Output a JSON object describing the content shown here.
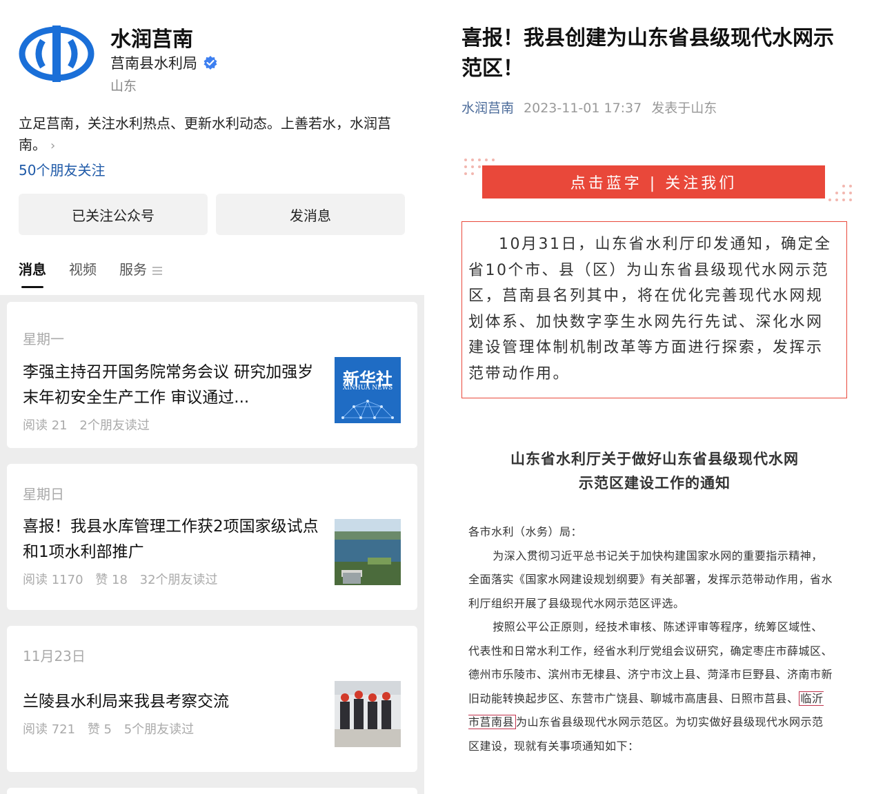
{
  "profile": {
    "name": "水润莒南",
    "org": "莒南县水利局",
    "region": "山东",
    "intro": "立足莒南，关注水利热点、更新水利动态。上善若水，水润莒南。",
    "friends": "50个朋友关注",
    "follow_button": "已关注公众号",
    "message_button": "发消息",
    "logo_color": "#1a6fd8",
    "verified_color": "#3d7ff0"
  },
  "tabs": [
    "消息",
    "视频",
    "服务"
  ],
  "feed": [
    {
      "day": "星期一",
      "title": "李强主持召开国务院常务会议 研究加强岁末年初安全生产工作 审议通过...",
      "stats": [
        "阅读 21",
        "2个朋友读过"
      ],
      "thumb_text": "新华社",
      "thumb_sub": "XINHUA NEWS"
    },
    {
      "day": "星期日",
      "title": "喜报！我县水库管理工作获2项国家级试点和1项水利部推广",
      "stats": [
        "阅读 1170",
        "赞 18",
        "32个朋友读过"
      ]
    },
    {
      "day": "11月23日",
      "title": "兰陵县水利局来我县考察交流",
      "stats": [
        "阅读 721",
        "赞 5",
        "5个朋友读过"
      ]
    }
  ],
  "article": {
    "title": "喜报！我县创建为山东省县级现代水网示范区！",
    "source": "水润莒南",
    "time": "2023-11-01 17:37",
    "location": "发表于山东",
    "banner": "点击蓝字 | 关注我们",
    "banner_color": "#e9483a",
    "quote": "10月31日，山东省水利厅印发通知，确定全省10个市、县（区）为山东省县级现代水网示范区，莒南县名列其中，将在优化完善现代水网规划体系、加快数字孪生水网先行先试、深化水网建设管理体制机制改革等方面进行探索，发挥示范带动作用。",
    "doc_title_line1": "山东省水利厅关于做好山东省县级现代水网",
    "doc_title_line2": "示范区建设工作的通知",
    "doc_greeting": "各市水利（水务）局：",
    "doc_p1": "为深入贯彻习近平总书记关于加快构建国家水网的重要指示精神，全面落实《国家水网建设规划纲要》有关部署，发挥示范带动作用，省水利厅组织开展了县级现代水网示范区评选。",
    "doc_p2_a": "按照公平公正原则，经技术审核、陈述评审等程序，统筹区域性、代表性和日常水利工作，经省水利厅党组会议研究，确定枣庄市薛城区、德州市乐陵市、滨州市无棣县、济宁市汶上县、菏泽市巨野县、济南市新旧动能转换起步区、东营市广饶县、聊城市高唐县、日照市莒县、",
    "doc_p2_hl": "临沂市莒南县",
    "doc_p2_b": "为山东省县级现代水网示范区。为切实做好县级现代水网示范区建设，现就有关事项通知如下："
  }
}
